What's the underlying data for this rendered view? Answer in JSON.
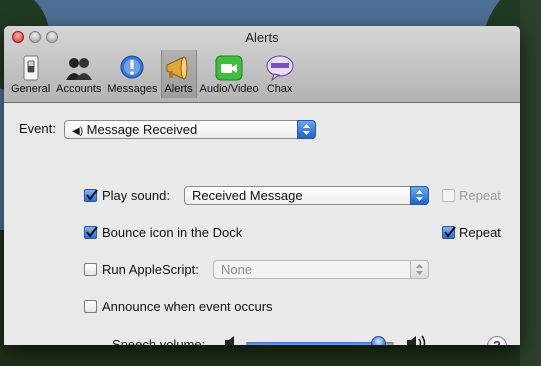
{
  "window": {
    "title": "Alerts"
  },
  "toolbar": {
    "items": [
      {
        "label": "General",
        "icon": "general-switch-icon"
      },
      {
        "label": "Accounts",
        "icon": "accounts-people-icon"
      },
      {
        "label": "Messages",
        "icon": "messages-exclamation-icon"
      },
      {
        "label": "Alerts",
        "icon": "alerts-megaphone-icon",
        "active": true
      },
      {
        "label": "Audio/Video",
        "icon": "video-camera-icon"
      },
      {
        "label": "Chax",
        "icon": "chax-bubble-icon"
      }
    ]
  },
  "event": {
    "label": "Event:",
    "value": "Message Received",
    "icon": "speaker-small-icon"
  },
  "play_sound": {
    "label": "Play sound:",
    "checked": true,
    "value": "Received Message",
    "repeat_label": "Repeat",
    "repeat_checked": false,
    "repeat_enabled": false
  },
  "bounce": {
    "label": "Bounce icon in the Dock",
    "checked": true,
    "repeat_label": "Repeat",
    "repeat_checked": true
  },
  "applescript": {
    "label": "Run AppleScript:",
    "checked": false,
    "value": "None",
    "enabled": false
  },
  "announce": {
    "label": "Announce when event occurs",
    "checked": false
  },
  "speech": {
    "label": "Speech volume:",
    "level": 0.94
  },
  "help": {
    "label": "?"
  },
  "colors": {
    "accent": "#2d6fd9",
    "help_glyph": "#5a2c9a"
  }
}
